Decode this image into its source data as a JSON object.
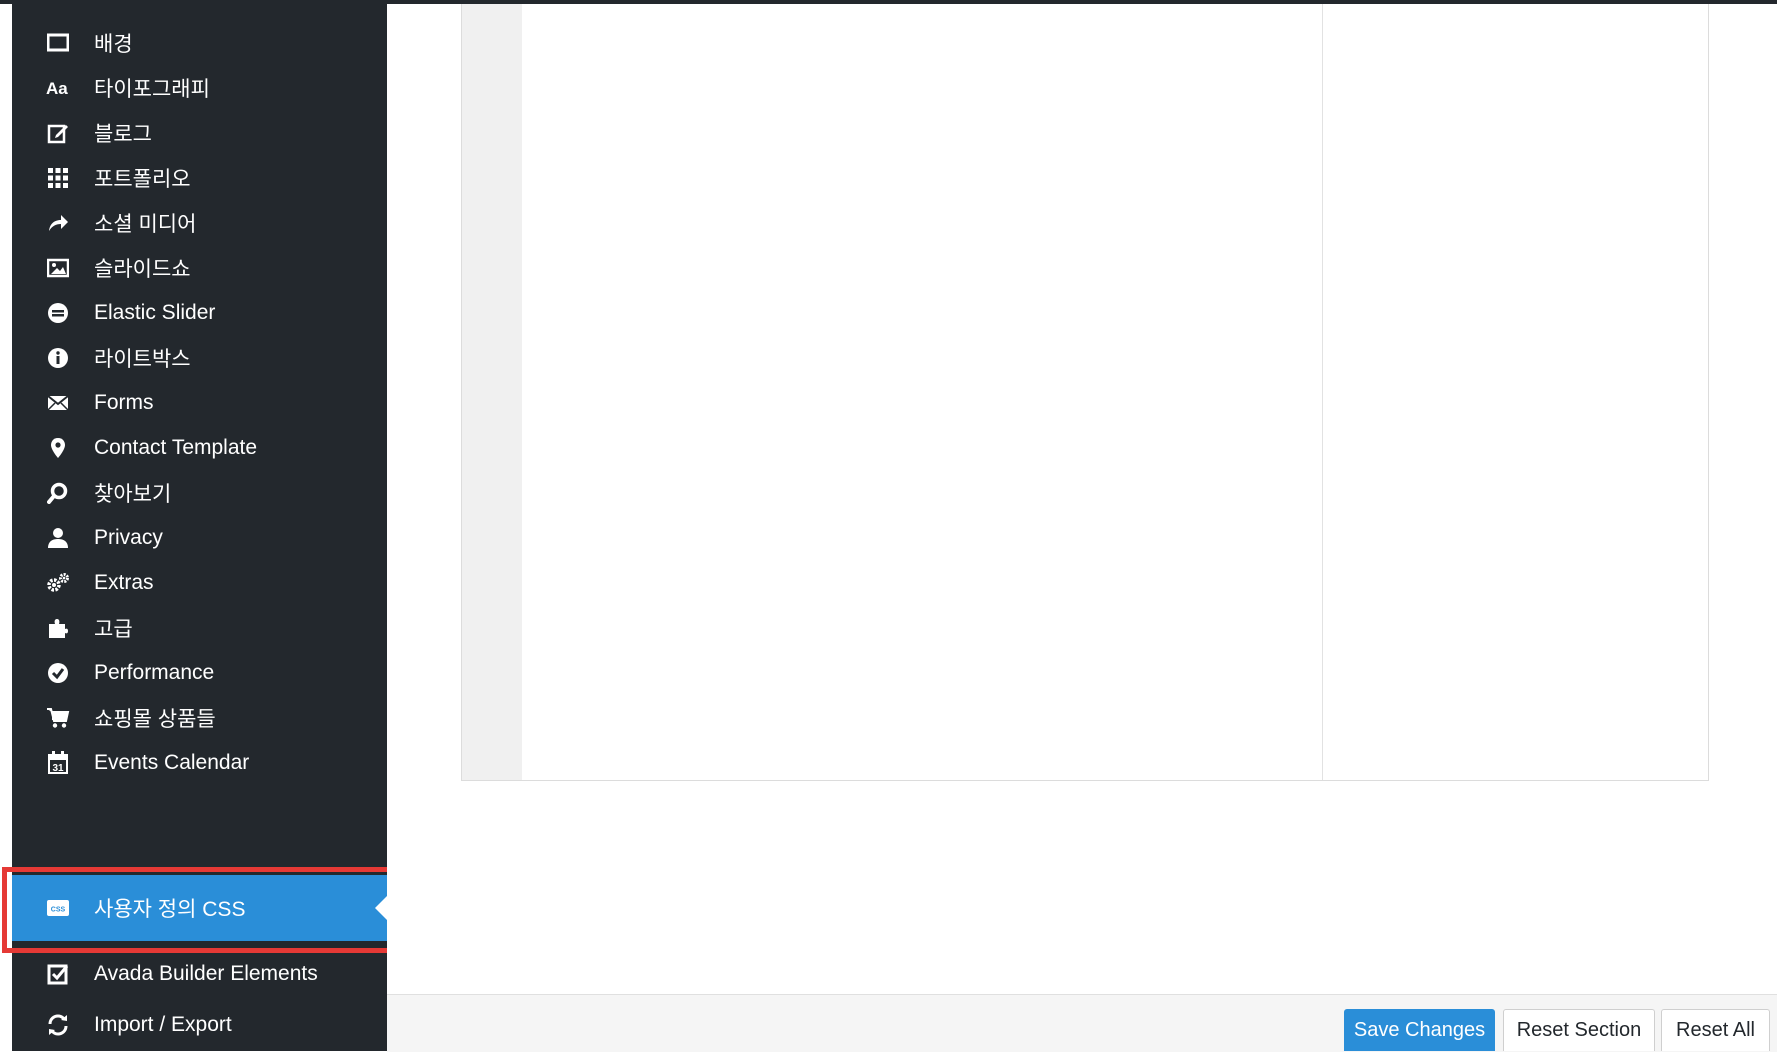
{
  "sidebar": {
    "items": [
      {
        "label": "배경",
        "icon": "monitor-icon"
      },
      {
        "label": "타이포그래피",
        "icon": "typography-icon"
      },
      {
        "label": "블로그",
        "icon": "edit-icon"
      },
      {
        "label": "포트폴리오",
        "icon": "grid-icon"
      },
      {
        "label": "소셜 미디어",
        "icon": "share-arrow-icon"
      },
      {
        "label": "슬라이드쇼",
        "icon": "image-icon"
      },
      {
        "label": "Elastic Slider",
        "icon": "slider-icon"
      },
      {
        "label": "라이트박스",
        "icon": "info-icon"
      },
      {
        "label": "Forms",
        "icon": "envelope-icon"
      },
      {
        "label": "Contact Template",
        "icon": "map-pin-icon"
      },
      {
        "label": "찾아보기",
        "icon": "search-icon"
      },
      {
        "label": "Privacy",
        "icon": "user-icon"
      },
      {
        "label": "Extras",
        "icon": "gears-icon"
      },
      {
        "label": "고급",
        "icon": "puzzle-icon"
      },
      {
        "label": "Performance",
        "icon": "check-circle-icon"
      },
      {
        "label": "쇼핑몰 상품들",
        "icon": "cart-icon"
      },
      {
        "label": "Events Calendar",
        "icon": "calendar-icon"
      },
      {
        "label": "사용자 정의 CSS",
        "icon": "css-icon",
        "active": true
      },
      {
        "label": "Avada Builder Elements",
        "icon": "checkbox-icon"
      },
      {
        "label": "Import / Export",
        "icon": "refresh-icon"
      }
    ],
    "calendar_day": "31",
    "css_badge": "CSS"
  },
  "footer": {
    "save_label": "Save Changes",
    "reset_section_label": "Reset Section",
    "reset_all_label": "Reset All"
  },
  "colors": {
    "sidebar_bg": "#23282d",
    "accent": "#2a8ed8",
    "highlight": "#e53935"
  }
}
